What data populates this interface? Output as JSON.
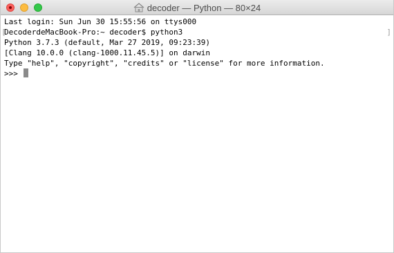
{
  "window": {
    "title": "decoder — Python — 80×24",
    "title_icon": "home-folder-icon",
    "controls": [
      "close",
      "minimize",
      "zoom"
    ]
  },
  "terminal": {
    "lines": [
      "Last login: Sun Jun 30 15:55:56 on ttys000",
      "DecoderdeMacBook-Pro:~ decoder$ python3",
      "Python 3.7.3 (default, Mar 27 2019, 09:23:39)",
      "[Clang 10.0.0 (clang-1000.11.45.5)] on darwin",
      "Type \"help\", \"copyright\", \"credits\" or \"license\" for more information."
    ],
    "prompt": ">>> ",
    "mark_left": "[",
    "mark_right": "]"
  },
  "colors": {
    "close": "#fc605c",
    "minimize": "#fdbc40",
    "zoom": "#34c84a",
    "cursor": "#8a8a8a"
  }
}
